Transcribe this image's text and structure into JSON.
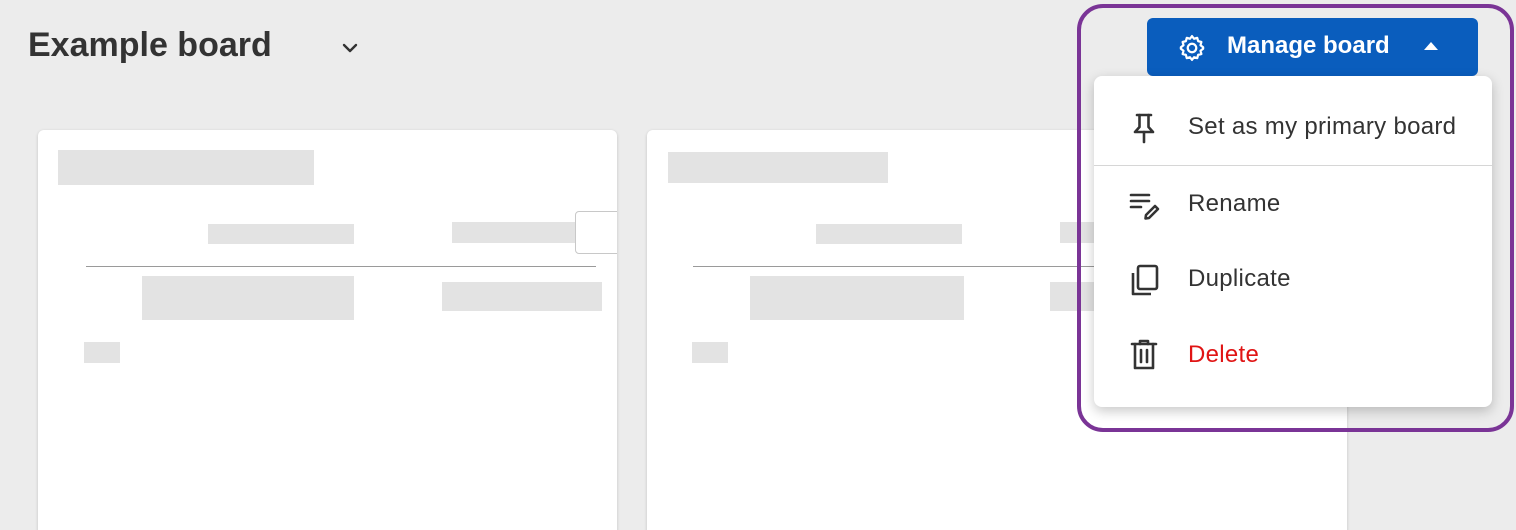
{
  "header": {
    "board_title": "Example board",
    "board_switcher_icon": "chevron-down-icon"
  },
  "manage_button": {
    "label": "Manage board",
    "icon": "gear-icon",
    "state_icon": "caret-up-icon",
    "color": "#0a5dbd"
  },
  "menu": {
    "items": [
      {
        "label": "Set as my primary board",
        "icon": "pin-icon"
      },
      {
        "label": "Rename",
        "icon": "rename-icon"
      },
      {
        "label": "Duplicate",
        "icon": "duplicate-icon"
      },
      {
        "label": "Delete",
        "icon": "trash-icon",
        "color": "#e01414"
      }
    ]
  },
  "colors": {
    "background": "#ececec",
    "highlight": "#7a3496",
    "danger": "#e01414"
  }
}
